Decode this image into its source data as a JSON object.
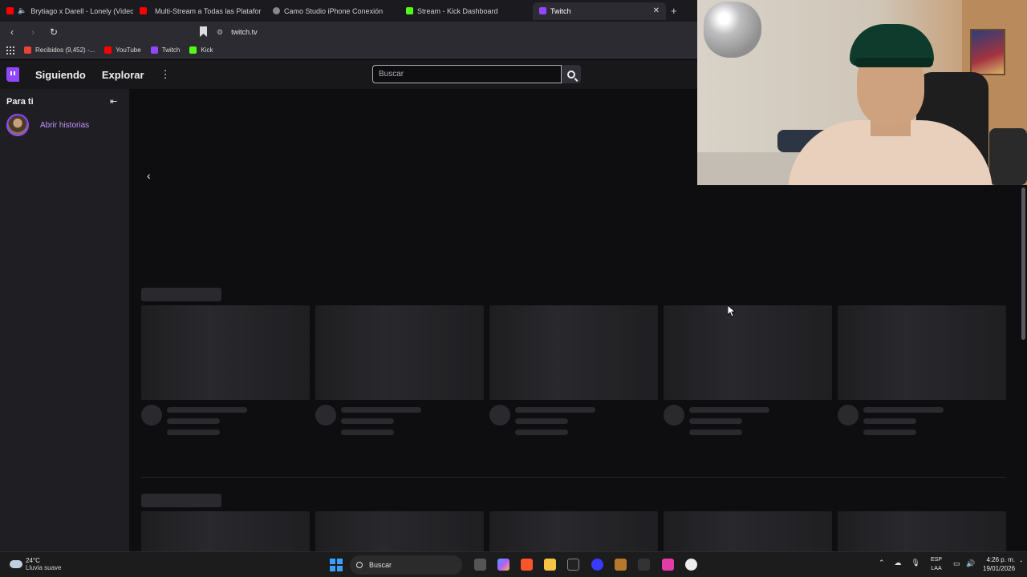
{
  "browser": {
    "tabs": [
      {
        "label": "Brytiago x Darell - Lonely (Video",
        "favicon_color": "#ff0000"
      },
      {
        "label": "Multi-Stream a Todas las Platafor",
        "favicon_color": "#ff0000"
      },
      {
        "label": "Camo Studio iPhone Conexión",
        "favicon_color": "#888888"
      },
      {
        "label": "Stream - Kick Dashboard",
        "favicon_color": "#53fc18"
      },
      {
        "label": "Twitch",
        "favicon_color": "#9147ff"
      }
    ],
    "new_tab_symbol": "+",
    "close_symbol": "✕",
    "url": "twitch.tv",
    "bookmarks": [
      {
        "label": "Recibidos (9,452) -...",
        "favicon_color": "#ea4335"
      },
      {
        "label": "YouTube",
        "favicon_color": "#ff0000"
      },
      {
        "label": "Twitch",
        "favicon_color": "#9147ff"
      },
      {
        "label": "Kick",
        "favicon_color": "#53fc18"
      }
    ]
  },
  "twitch": {
    "nav": {
      "following": "Siguiendo",
      "explore": "Explorar",
      "more_symbol": "⋮"
    },
    "search": {
      "placeholder": "Buscar"
    },
    "sidebar": {
      "heading": "Para ti",
      "collapse_symbol": "⇤",
      "stories_label": "Abrir historias"
    },
    "carousel_prev_symbol": "‹",
    "accent": "#9147ff"
  },
  "taskbar": {
    "weather": {
      "temp": "24°C",
      "desc": "Lluvia suave"
    },
    "search": "Buscar",
    "lang": {
      "top": "ESP",
      "bottom": "LAA"
    },
    "time": "4:26 p. m.",
    "date": "19/01/2026"
  }
}
